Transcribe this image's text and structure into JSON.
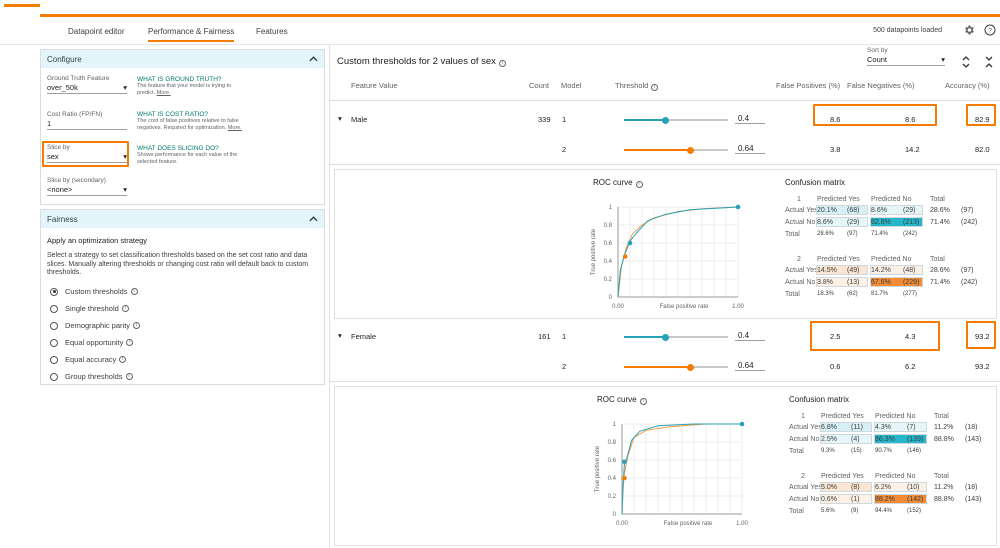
{
  "tabs": [
    {
      "label": "Datapoint editor"
    },
    {
      "label": "Performance & Fairness"
    },
    {
      "label": "Features"
    }
  ],
  "status": {
    "loaded": "500 datapoints loaded"
  },
  "colors": {
    "accent": "#f57c00",
    "teal": "#26a3b8",
    "highlight": "#ef7d23"
  },
  "configure": {
    "title": "Configure",
    "gt_label": "Ground Truth Feature",
    "gt_value": "over_50k",
    "gt_help_title": "WHAT IS GROUND TRUTH?",
    "gt_help_desc": "The feature that your model is trying to predict.",
    "gt_more": "More.",
    "cost_label": "Cost Ratio (FP/FN)",
    "cost_value": "1",
    "cost_help_title": "WHAT IS COST RATIO?",
    "cost_help_desc": "The cost of false positives relative to false negatives. Required for optimization.",
    "cost_more": "More.",
    "slice_label": "Slice by",
    "slice_value": "sex",
    "slice_help_title": "WHAT DOES SLICING DO?",
    "slice_help_desc": "Shows performance for each value of the selected feature.",
    "slice2_label": "Slice by (secondary)",
    "slice2_value": "<none>"
  },
  "fairness": {
    "title": "Fairness",
    "heading": "Apply an optimization strategy",
    "desc": "Select a strategy to set classification thresholds based on the set cost ratio and data slices. Manually altering thresholds or changing cost ratio will default back to custom thresholds.",
    "options": [
      {
        "label": "Custom thresholds",
        "selected": true
      },
      {
        "label": "Single threshold",
        "selected": false
      },
      {
        "label": "Demographic parity",
        "selected": false
      },
      {
        "label": "Equal opportunity",
        "selected": false
      },
      {
        "label": "Equal accuracy",
        "selected": false
      },
      {
        "label": "Group thresholds",
        "selected": false
      }
    ]
  },
  "main": {
    "title": "Custom thresholds for 2 values of sex",
    "sort_label": "Sort by",
    "sort_value": "Count",
    "headers": {
      "feature": "Feature Value",
      "count": "Count",
      "model": "Model",
      "threshold": "Threshold",
      "fp": "False Positives (%)",
      "fn": "False Negatives (%)",
      "acc": "Accuracy (%)"
    },
    "groups": [
      {
        "name": "Male",
        "count": "339",
        "models": [
          {
            "model": "1",
            "threshold": "0.4",
            "thr_value": 0.4,
            "fp": "8.6",
            "fn": "8.6",
            "acc": "82.9"
          },
          {
            "model": "2",
            "threshold": "0.64",
            "thr_value": 0.64,
            "fp": "3.8",
            "fn": "14.2",
            "acc": "82.0"
          }
        ]
      },
      {
        "name": "Female",
        "count": "161",
        "models": [
          {
            "model": "1",
            "threshold": "0.4",
            "thr_value": 0.4,
            "fp": "2.5",
            "fn": "4.3",
            "acc": "93.2"
          },
          {
            "model": "2",
            "threshold": "0.64",
            "thr_value": 0.64,
            "fp": "0.6",
            "fn": "6.2",
            "acc": "93.2"
          }
        ]
      }
    ]
  },
  "details": [
    {
      "roc_title": "ROC curve",
      "cm_title": "Confusion matrix",
      "ylabel": "True positive rate",
      "xlabel": "False positive rate",
      "yticks": [
        "1",
        "0.8",
        "0.6",
        "0.4",
        "0.2",
        "0"
      ],
      "xticks": [
        "0.00",
        "1.00"
      ],
      "cm_header": {
        "pred_yes": "Predicted Yes",
        "pred_no": "Predicted No",
        "total": "Total"
      },
      "models": [
        {
          "id": "1",
          "rows": [
            {
              "label": "Actual Yes",
              "a": "20.1%",
              "an": "(68)",
              "b": "8.6%",
              "bn": "(29)",
              "t": "28.6%",
              "tn": "(97)"
            },
            {
              "label": "Actual No",
              "a": "8.6%",
              "an": "(29)",
              "b": "62.8%",
              "bn": "(213)",
              "t": "71.4%",
              "tn": "(242)"
            },
            {
              "label": "Total",
              "a": "28.6%",
              "an": "(97)",
              "b": "71.4%",
              "bn": "(242)",
              "t": "",
              "tn": ""
            }
          ]
        },
        {
          "id": "2",
          "rows": [
            {
              "label": "Actual Yes",
              "a": "14.5%",
              "an": "(49)",
              "b": "14.2%",
              "bn": "(48)",
              "t": "28.6%",
              "tn": "(97)"
            },
            {
              "label": "Actual No",
              "a": "3.8%",
              "an": "(13)",
              "b": "67.6%",
              "bn": "(229)",
              "t": "71.4%",
              "tn": "(242)"
            },
            {
              "label": "Total",
              "a": "18.3%",
              "an": "(62)",
              "b": "81.7%",
              "bn": "(277)",
              "t": "",
              "tn": ""
            }
          ]
        }
      ]
    },
    {
      "roc_title": "ROC curve",
      "cm_title": "Confusion matrix",
      "ylabel": "True positive rate",
      "xlabel": "False positive rate",
      "yticks": [
        "1",
        "0.8",
        "0.6",
        "0.4",
        "0.2",
        "0"
      ],
      "xticks": [
        "0.00",
        "1.00"
      ],
      "cm_header": {
        "pred_yes": "Predicted Yes",
        "pred_no": "Predicted No",
        "total": "Total"
      },
      "models": [
        {
          "id": "1",
          "rows": [
            {
              "label": "Actual Yes",
              "a": "6.8%",
              "an": "(11)",
              "b": "4.3%",
              "bn": "(7)",
              "t": "11.2%",
              "tn": "(18)"
            },
            {
              "label": "Actual No",
              "a": "2.5%",
              "an": "(4)",
              "b": "86.3%",
              "bn": "(139)",
              "t": "88.8%",
              "tn": "(143)"
            },
            {
              "label": "Total",
              "a": "9.3%",
              "an": "(15)",
              "b": "90.7%",
              "bn": "(146)",
              "t": "",
              "tn": ""
            }
          ]
        },
        {
          "id": "2",
          "rows": [
            {
              "label": "Actual Yes",
              "a": "5.0%",
              "an": "(8)",
              "b": "6.2%",
              "bn": "(10)",
              "t": "11.2%",
              "tn": "(18)"
            },
            {
              "label": "Actual No",
              "a": "0.6%",
              "an": "(1)",
              "b": "88.2%",
              "bn": "(142)",
              "t": "88.8%",
              "tn": "(143)"
            },
            {
              "label": "Total",
              "a": "5.6%",
              "an": "(9)",
              "b": "94.4%",
              "bn": "(152)",
              "t": "",
              "tn": ""
            }
          ]
        }
      ]
    }
  ]
}
